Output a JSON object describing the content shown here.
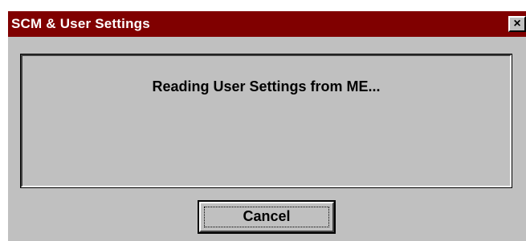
{
  "window": {
    "title": "SCM & User Settings",
    "close_glyph": "×",
    "close_icon": "close-icon"
  },
  "message": {
    "text": "Reading User Settings from ME..."
  },
  "buttons": {
    "cancel_label": "Cancel"
  },
  "colors": {
    "titlebar": "#800000",
    "dialog_face": "#c0c0c0",
    "title_text": "#ffffff"
  }
}
